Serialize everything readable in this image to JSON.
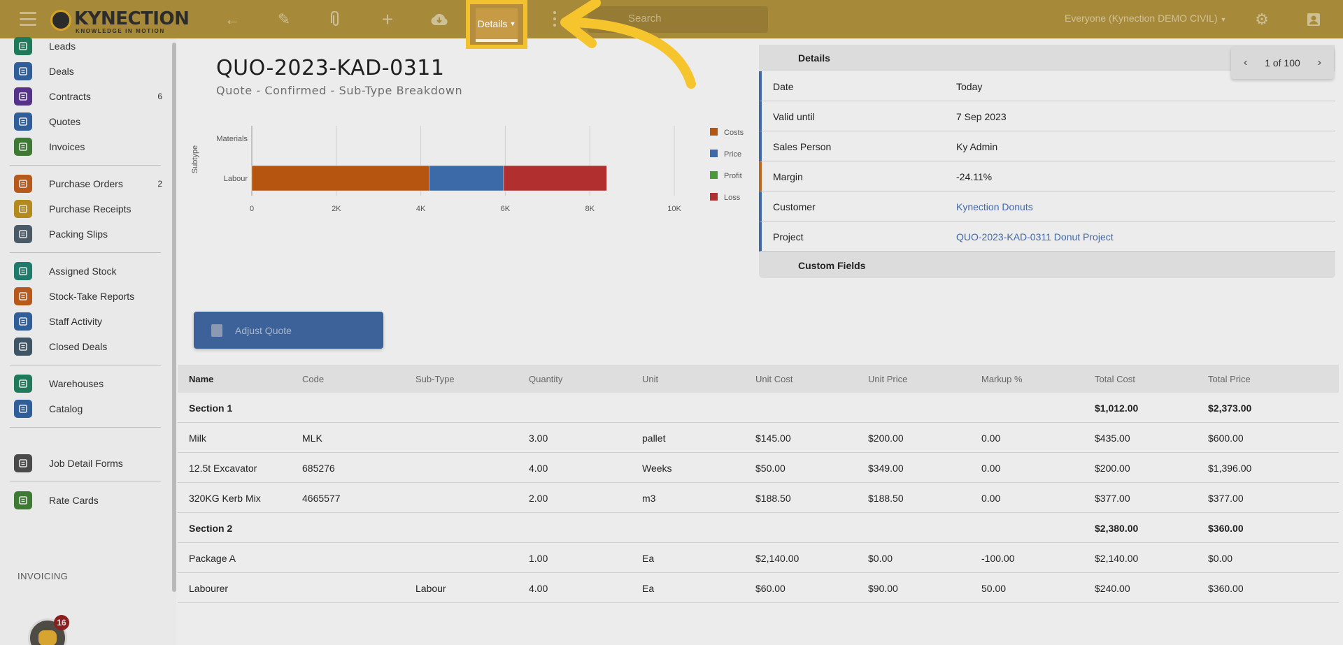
{
  "app": {
    "logo_word": "KYNECTION",
    "logo_tagline": "KNOWLEDGE IN MOTION",
    "details_label": "Details",
    "search_placeholder": "Search",
    "workspace": "Everyone (Kynection DEMO CIVIL)"
  },
  "sidebar": {
    "items": [
      {
        "label": "Leads",
        "count": "",
        "color": "#1e7a5a",
        "icon": "person-icon"
      },
      {
        "label": "Deals",
        "count": "",
        "color": "#2f5e99",
        "icon": "bar-chart-icon"
      },
      {
        "label": "Contracts",
        "count": "6",
        "color": "#55338a",
        "icon": "document-icon"
      },
      {
        "label": "Quotes",
        "count": "",
        "color": "#2f5e99",
        "icon": "document-icon"
      },
      {
        "label": "Invoices",
        "count": "",
        "color": "#3f7a35",
        "icon": "document-icon"
      },
      {
        "label": "Purchase Orders",
        "count": "2",
        "color": "#b55a1c",
        "icon": "document-icon"
      },
      {
        "label": "Purchase Receipts",
        "count": "",
        "color": "#b28a1e",
        "icon": "document-icon"
      },
      {
        "label": "Packing Slips",
        "count": "",
        "color": "#4a5a66",
        "icon": "truck-icon"
      },
      {
        "label": "Assigned Stock",
        "count": "",
        "color": "#1e7a6a",
        "icon": "checklist-icon"
      },
      {
        "label": "Stock-Take Reports",
        "count": "",
        "color": "#b55a1c",
        "icon": "clipboard-icon"
      },
      {
        "label": "Staff Activity",
        "count": "",
        "color": "#2f5e99",
        "icon": "person-icon"
      },
      {
        "label": "Closed Deals",
        "count": "",
        "color": "#3e5566",
        "icon": "bar-chart-icon"
      },
      {
        "label": "Warehouses",
        "count": "",
        "color": "#1e7a5a",
        "icon": "warehouse-icon"
      },
      {
        "label": "Catalog",
        "count": "",
        "color": "#2f5e99",
        "icon": "list-icon"
      },
      {
        "label": "Job Detail Forms",
        "count": "",
        "color": "#4a4a4a",
        "icon": "clipboard-icon"
      },
      {
        "label": "Rate Cards",
        "count": "",
        "color": "#3f7a35",
        "icon": "dollar-icon"
      }
    ],
    "section_heading": "INVOICING",
    "assistant_badge": "16"
  },
  "quote": {
    "title": "QUO-2023-KAD-0311",
    "subtitle": "Quote - Confirmed - Sub-Type Breakdown",
    "adjust_label": "Adjust Quote"
  },
  "chart_data": {
    "type": "bar",
    "orientation": "horizontal",
    "stacked": true,
    "categories": [
      "Materials",
      "Labour"
    ],
    "series": [
      {
        "name": "Costs",
        "color": "#b55510",
        "values": [
          0,
          4200
        ]
      },
      {
        "name": "Price",
        "color": "#3c6aa8",
        "values": [
          0,
          1760
        ]
      },
      {
        "name": "Profit",
        "color": "#4a9a3a",
        "values": [
          0,
          0
        ]
      },
      {
        "name": "Loss",
        "color": "#b12f2f",
        "values": [
          0,
          2440
        ]
      }
    ],
    "ylabel": "Subtype",
    "xlim": [
      0,
      10000
    ],
    "xticks": [
      "0",
      "2K",
      "4K",
      "6K",
      "8K",
      "10K"
    ],
    "grid": true,
    "legend": "right"
  },
  "details": {
    "heading": "Details",
    "rows": [
      {
        "key": "Date",
        "value": "Today",
        "link": false
      },
      {
        "key": "Valid until",
        "value": "7 Sep 2023",
        "link": false
      },
      {
        "key": "Sales Person",
        "value": "Ky Admin",
        "link": false
      },
      {
        "key": "Margin",
        "value": "-24.11%",
        "link": false
      },
      {
        "key": "Customer",
        "value": "Kynection Donuts",
        "link": true
      },
      {
        "key": "Project",
        "value": "QUO-2023-KAD-0311 Donut Project",
        "link": true
      }
    ],
    "custom_heading": "Custom Fields",
    "pager": "1 of 100"
  },
  "table": {
    "columns": [
      "Name",
      "Code",
      "Sub-Type",
      "Quantity",
      "Unit",
      "Unit Cost",
      "Unit Price",
      "Markup %",
      "Total Cost",
      "Total Price"
    ],
    "rows": [
      {
        "section": true,
        "cells": [
          "Section 1",
          "",
          "",
          "",
          "",
          "",
          "",
          "",
          "$1,012.00",
          "$2,373.00"
        ]
      },
      {
        "section": false,
        "cells": [
          "Milk",
          "MLK",
          "",
          "3.00",
          "pallet",
          "$145.00",
          "$200.00",
          "0.00",
          "$435.00",
          "$600.00"
        ]
      },
      {
        "section": false,
        "cells": [
          "12.5t Excavator",
          "685276",
          "",
          "4.00",
          "Weeks",
          "$50.00",
          "$349.00",
          "0.00",
          "$200.00",
          "$1,396.00"
        ]
      },
      {
        "section": false,
        "cells": [
          "320KG Kerb Mix",
          "4665577",
          "",
          "2.00",
          "m3",
          "$188.50",
          "$188.50",
          "0.00",
          "$377.00",
          "$377.00"
        ]
      },
      {
        "section": true,
        "cells": [
          "Section 2",
          "",
          "",
          "",
          "",
          "",
          "",
          "",
          "$2,380.00",
          "$360.00"
        ]
      },
      {
        "section": false,
        "cells": [
          "Package A",
          "",
          "",
          "1.00",
          "",
          "Ea",
          "$2,140.00",
          "$0.00",
          "-100.00",
          "$2,140.00",
          "$0.00"
        ]
      },
      {
        "section": false,
        "cells": [
          "Labourer",
          "",
          "Labour",
          "4.00",
          "Ea",
          "$60.00",
          "$90.00",
          "50.00",
          "$240.00",
          "$360.00"
        ]
      }
    ]
  }
}
